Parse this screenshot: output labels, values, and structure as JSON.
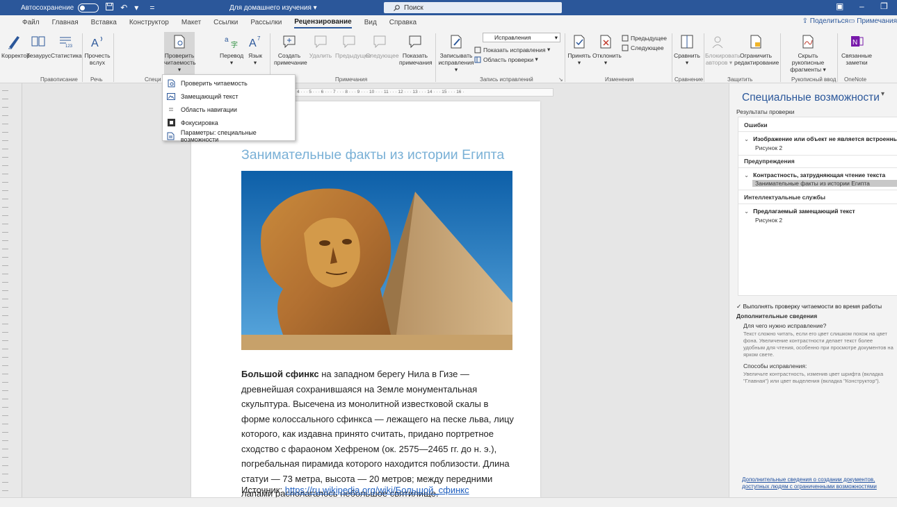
{
  "titlebar": {
    "autosave_label": "Автосохранение",
    "doc_title": "Для домашнего изучения",
    "search_placeholder": "Поиск",
    "accent": "#2b579a"
  },
  "menu_tabs": [
    {
      "label": "Файл"
    },
    {
      "label": "Главная"
    },
    {
      "label": "Вставка"
    },
    {
      "label": "Конструктор"
    },
    {
      "label": "Макет"
    },
    {
      "label": "Ссылки"
    },
    {
      "label": "Рассылки"
    },
    {
      "label": "Рецензирование",
      "active": true
    },
    {
      "label": "Вид"
    },
    {
      "label": "Справка"
    }
  ],
  "share_label": "Поделиться",
  "comments_label": "Примечания",
  "ribbon": {
    "corrector": "Корректор",
    "thesaurus": "Тезаурус",
    "stats": "Статистика",
    "read_aloud_1": "Прочесть",
    "read_aloud_2": "вслух",
    "check_1": "Проверить",
    "check_2": "читаемость",
    "translate": "Перевод",
    "language": "Язык",
    "new_comment_1": "Создать",
    "new_comment_2": "примечание",
    "delete": "Удалить",
    "previous": "Предыдущее",
    "next": "Следующее",
    "show_comments_1": "Показать",
    "show_comments_2": "примечания",
    "track_1": "Записывать",
    "track_2": "исправления",
    "markup_dropdown": "Исправления",
    "show_markup": "Показать исправления",
    "reviewing_pane": "Область проверки",
    "accept": "Принять",
    "reject": "Отклонить",
    "prev_change": "Предыдущее",
    "next_change": "Следующее",
    "compare": "Сравнить",
    "block_1": "Блокировать",
    "block_2": "авторов",
    "restrict_1": "Ограничить",
    "restrict_2": "редактирование",
    "hide_ink_1": "Скрыть рукописные",
    "hide_ink_2": "фрагменты",
    "linked_1": "Связанные",
    "linked_2": "заметки",
    "groups": {
      "proofing": "Правописание",
      "speech": "Речь",
      "special": "Специ",
      "comments": "Примечания",
      "tracking": "Запись исправлений",
      "changes": "Изменения",
      "compare": "Сравнение",
      "protect": "Защитить",
      "ink": "Рукописный ввод",
      "onenote": "OneNote"
    }
  },
  "check_menu": [
    {
      "label": "Проверить читаемость",
      "icon": "accessibility-check-icon"
    },
    {
      "label": "Замещающий текст",
      "icon": "alt-text-icon"
    },
    {
      "label": "Область навигации",
      "icon": "navigation-pane-icon"
    },
    {
      "label": "Фокусировка",
      "icon": "focus-icon"
    },
    {
      "label": "Параметры: специальные возможности",
      "icon": "accessibility-options-icon"
    }
  ],
  "ruler_text": "4 · · · 5 · · · 6 · · · 7 · · · 8 · · · 9 · · · 10 · · · 11 · · · 12 · · · 13 · · · 14 · · · 15 · · · 16 ·",
  "document": {
    "heading": "Занимательные факты из истории Египта",
    "heading_color": "#79b0d6",
    "para_bold": "Большой сфинкс",
    "para_rest": " на западном берегу Нила в Гизе — древнейшая сохранившаяся на Земле монументальная скульптура. Высечена из монолитной известковой скалы в форме колоссального сфинкса — лежащего на песке льва, лицу которого, как издавна принято считать, придано портретное сходство с фараоном Хефреном (ок. 2575—2465 гг. до н. э.), погребальная пирамида которого находится поблизости. Длина статуи — 73 метра, высота — 20 метров; между передними лапами располагалось небольшое святилище.",
    "source_label": "Источник:",
    "source_link": "https://ru.wikipedia.org/wiki/Большой_сфинкс"
  },
  "pane": {
    "title": "Специальные возможности",
    "results_label": "Результаты проверки",
    "errors_label": "Ошибки",
    "error_item": "Изображение или объект не является встроенным",
    "error_sub": "Рисунок 2",
    "warnings_label": "Предупреждения",
    "warning_item": "Контрастность, затрудняющая чтение текста",
    "warning_sub": "Занимательные факты из истории Египта",
    "intel_label": "Интеллектуальные службы",
    "intel_item": "Предлагаемый замещающий текст",
    "intel_sub": "Рисунок 2",
    "keep_checking": "Выполнять проверку читаемости во время работы",
    "additional": "Дополнительные сведения",
    "why_q": "Для чего нужно исправление?",
    "why_text": "Текст сложно читать, если его цвет слишком похож на цвет фона. Увеличение контрастности делает текст более удобным для чтения, особенно при просмотре документов на ярком свете.",
    "how_q": "Способы исправления:",
    "how_text": "Увеличьте контрастность, изменив цвет шрифта (вкладка \"Главная\") или цвет выделения (вкладка \"Конструктор\").",
    "link": "Дополнительные сведения о создании документов, доступных людям с ограниченными возможностями"
  }
}
